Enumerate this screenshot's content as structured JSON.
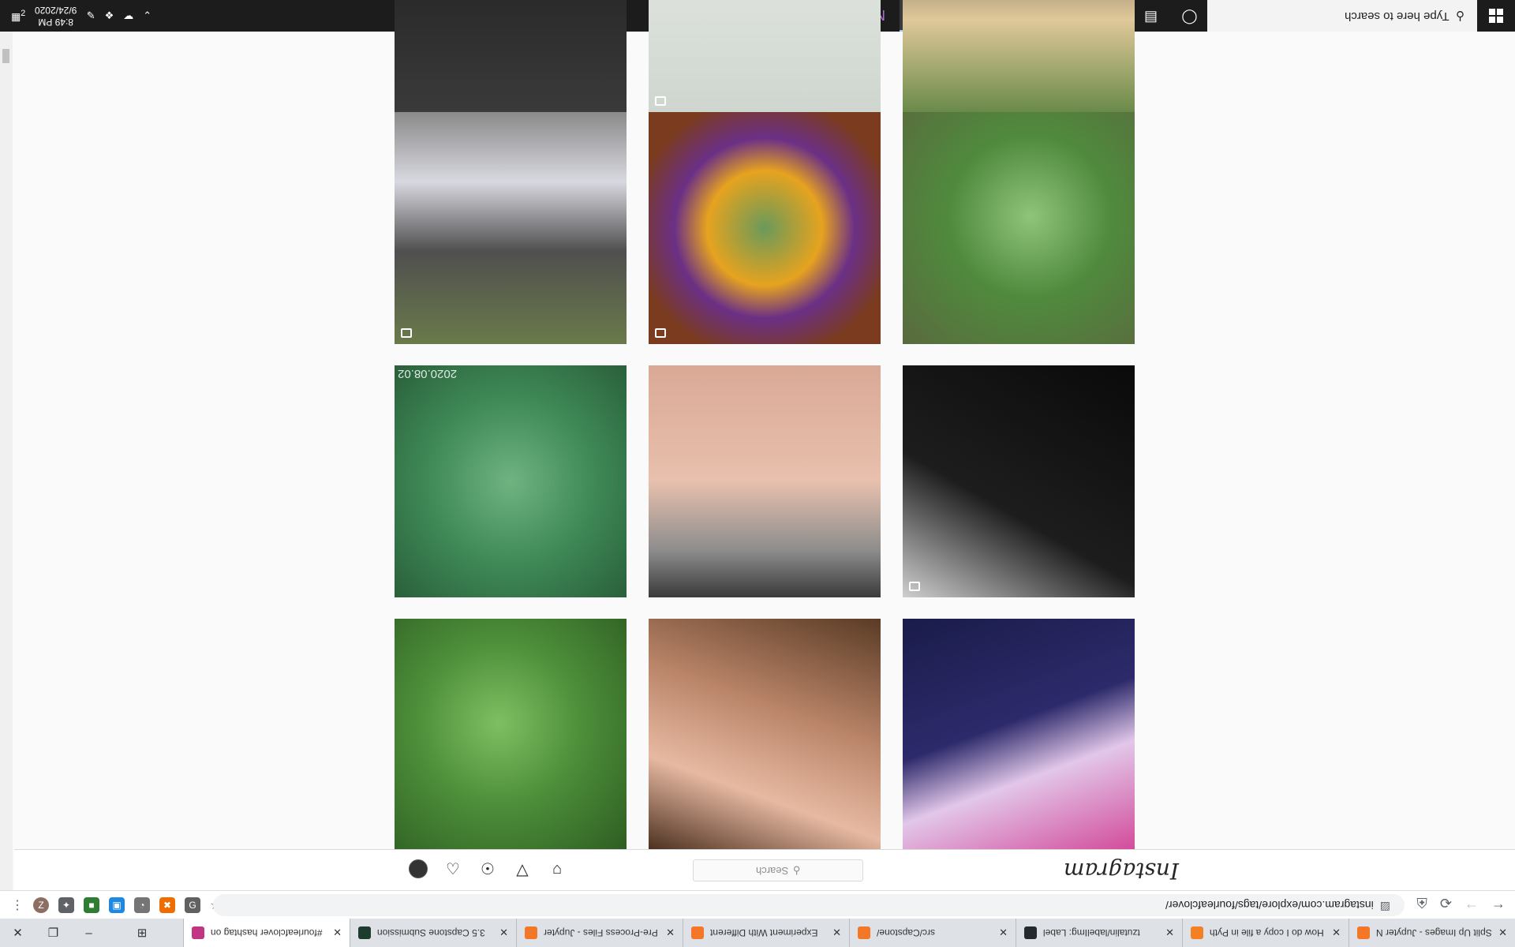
{
  "taskbar": {
    "search_placeholder": "Type here to search",
    "clock_time": "8:49 PM",
    "clock_date": "9/24/2020",
    "notification_count": "2",
    "apps": [
      "file-explorer",
      "blender",
      "python",
      "terminal",
      "onenote",
      "chrome",
      "photos",
      "substance-designer",
      "explorer",
      "edge",
      "store",
      "task-view",
      "cortana"
    ]
  },
  "browser": {
    "url": "instagram.com/explore/tags/fourleafclover/",
    "profile_initial": "Z",
    "tabs": [
      {
        "title": "Split Up Images - Jupyter N",
        "color": "#f37726"
      },
      {
        "title": "How do I copy a file in Pyth",
        "color": "#f48024"
      },
      {
        "title": "tzutalin/labelImg: Label",
        "color": "#24292e"
      },
      {
        "title": "src/Capstone/",
        "color": "#f37726"
      },
      {
        "title": "Experiment With Different",
        "color": "#f37726"
      },
      {
        "title": "Pre-Process Files - Jupyter",
        "color": "#f37726"
      },
      {
        "title": "3.5 Capstone Submission",
        "color": "#1f3a2f"
      },
      {
        "title": "#fourleafclover hashtag on",
        "color": "#c13584"
      }
    ]
  },
  "instagram": {
    "logo": "Instagram",
    "search_placeholder": "Search",
    "tile_stamp": "2020.08.02",
    "tiles": [
      {
        "name": "tile-unicorn-art",
        "bg": "linear-gradient(160deg,#1a1c4a 0%,#2d2a6b 45%,#e2c7e9 65%,#d24a9a 100%)"
      },
      {
        "name": "tile-hand-clover",
        "bg": "linear-gradient(200deg,#5a3b25 0%,#b98468 40%,#e7b9a2 70%,#4a2f1e 100%)"
      },
      {
        "name": "tile-clover-leaves",
        "bg": "radial-gradient(circle at 45% 45%,#7fbf62 0%,#4d8f3a 45%,#2e5d22 100%)"
      },
      {
        "name": "tile-necklace-black",
        "bg": "linear-gradient(210deg,#0a0a0a 0%,#1d1d1d 60%,#cfcfcf 100%)"
      },
      {
        "name": "tile-wrist-tattoo",
        "bg": "linear-gradient(180deg,#d9a996 0%,#e8c0ad 50%,#8c8c8c 80%,#3a3a3a 100%)"
      },
      {
        "name": "tile-clover-patch",
        "bg": "radial-gradient(circle at 50% 50%,#6fb381 0%,#3f8a57 50%,#2a5f3a 100%)"
      },
      {
        "name": "tile-clover-grass",
        "bg": "radial-gradient(circle at 55% 45%,#8fc47a 0%,#4f8a3d 45%,#5a6a3e 100%)"
      },
      {
        "name": "tile-clover-flower-resin",
        "bg": "radial-gradient(circle at 50% 50%,#6a9a5a 0%,#e6a31f 35%,#6b2f86 55%,#7a3b1e 80%)"
      },
      {
        "name": "tile-fairy-door",
        "bg": "linear-gradient(180deg,#8a8a8a 0%,#d8d8e0 30%,#4f4f4f 60%,#6a7a4a 100%)"
      },
      {
        "name": "tile-lace-crop",
        "bg": "linear-gradient(180deg,#1a1a1a 0%,#3a3a3a 100%)"
      },
      {
        "name": "tile-beads-crop",
        "bg": "linear-gradient(180deg,#e9ece9 0%,#cfd6cf 100%)"
      },
      {
        "name": "tile-sign-crop",
        "bg": "linear-gradient(180deg,#1a1a1a 0%,#e0c89a 60%,#6a8a4a 100%)"
      }
    ]
  }
}
